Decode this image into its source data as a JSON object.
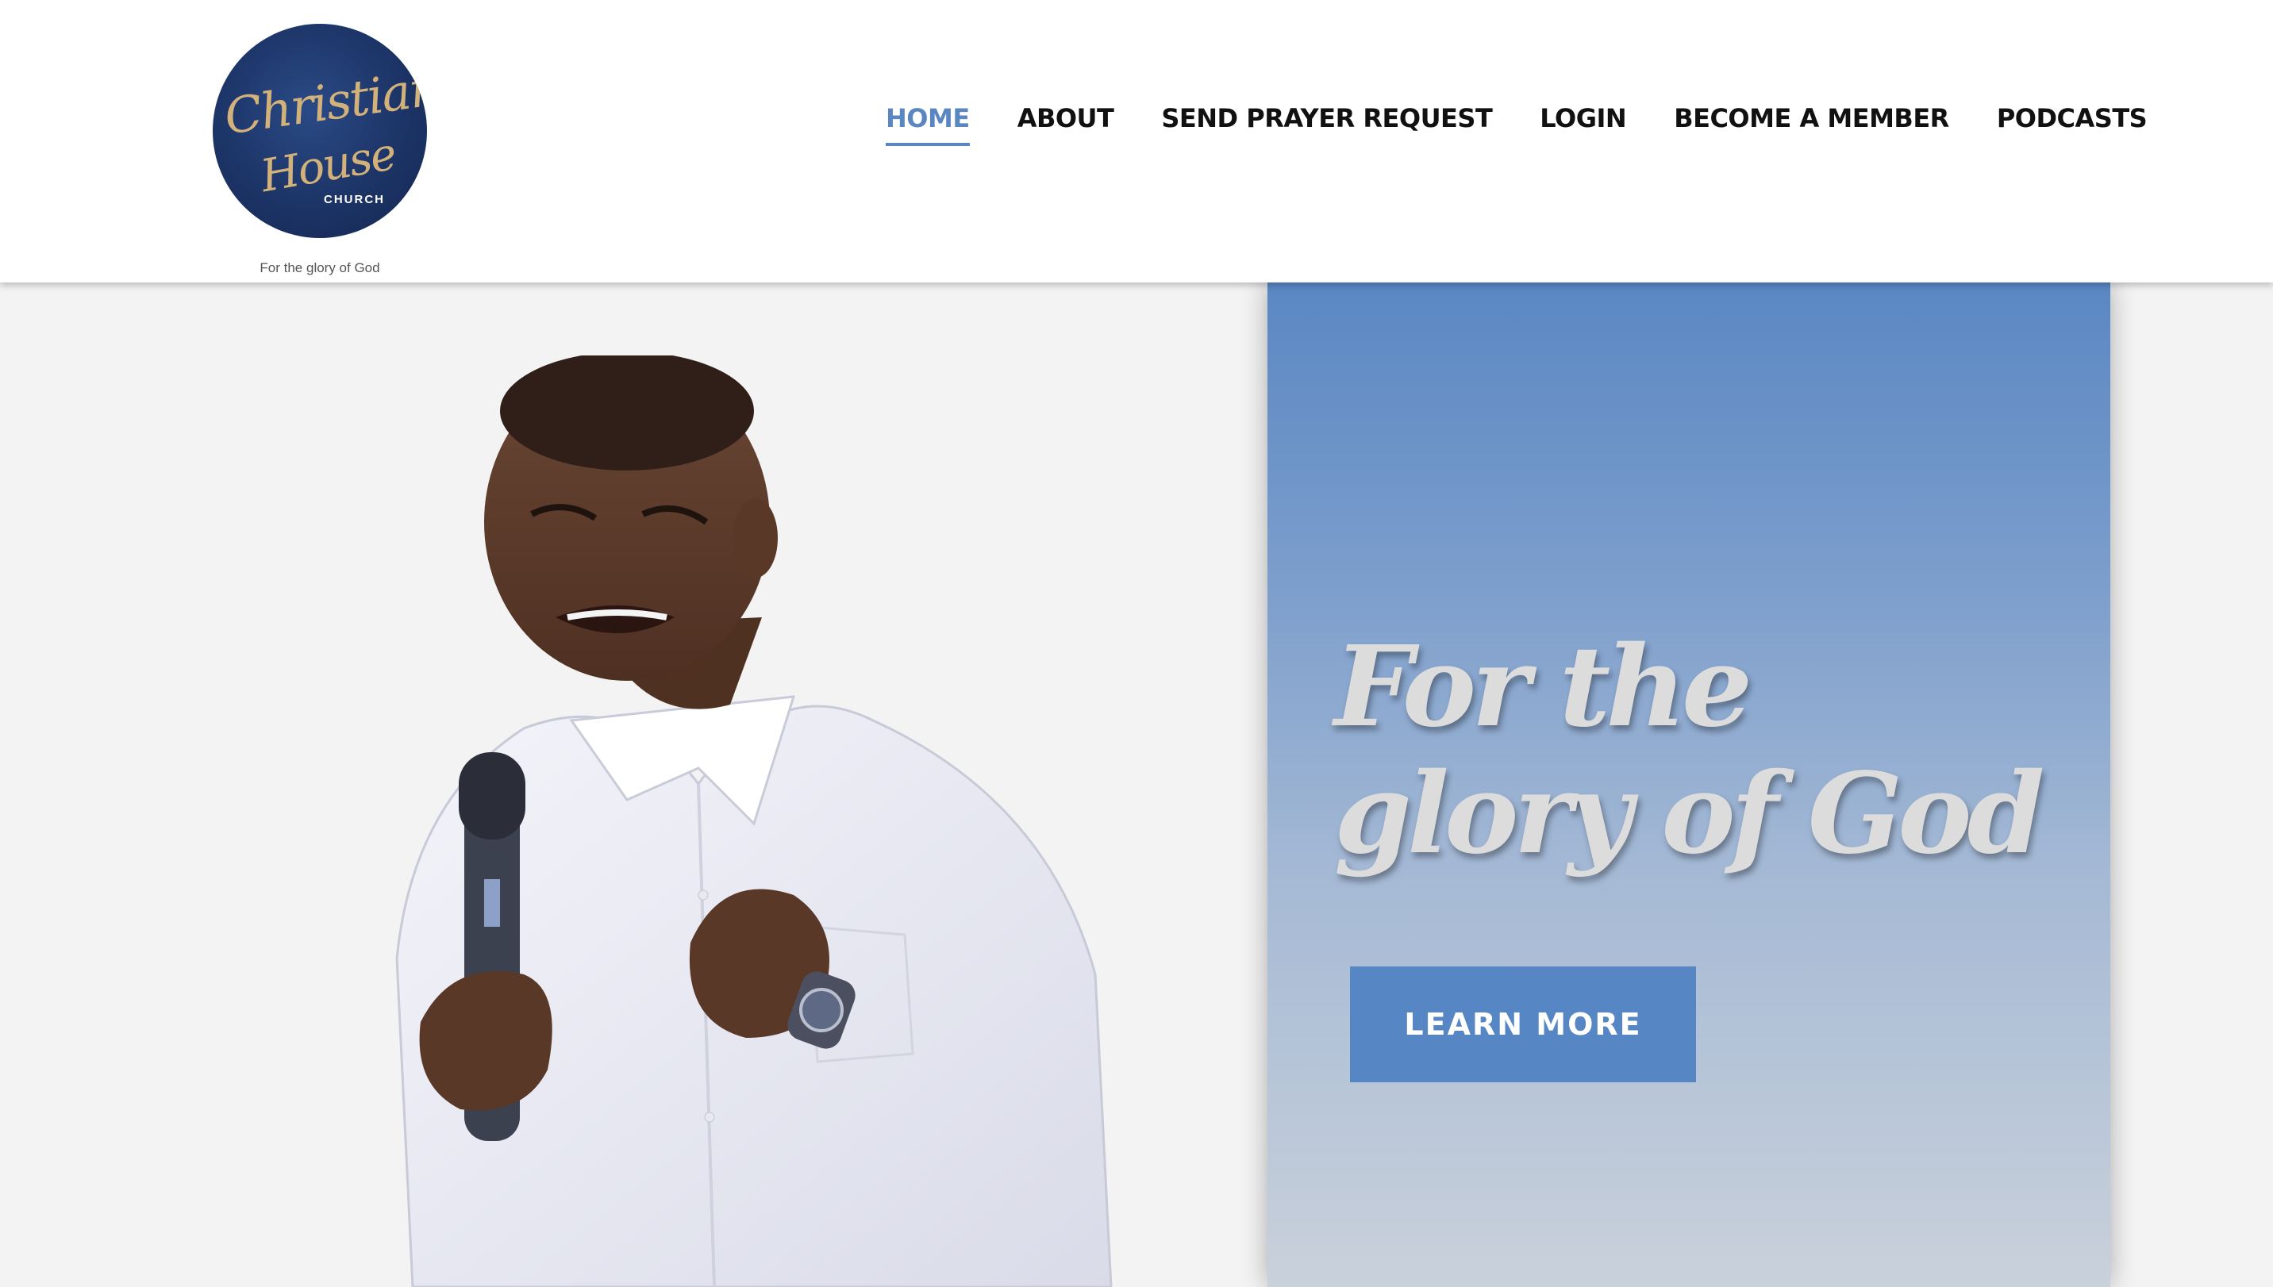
{
  "logo": {
    "line1": "Christian",
    "line2": "House",
    "line3": "CHURCH",
    "tagline": "For the glory of God"
  },
  "nav": {
    "items": [
      {
        "label": "HOME",
        "active": true
      },
      {
        "label": "ABOUT",
        "active": false
      },
      {
        "label": "SEND PRAYER REQUEST",
        "active": false
      },
      {
        "label": "LOGIN",
        "active": false
      },
      {
        "label": "BECOME A MEMBER",
        "active": false
      },
      {
        "label": "PODCASTS",
        "active": false
      }
    ]
  },
  "hero": {
    "heading": "For the glory of God",
    "button_label": "LEARN MORE"
  },
  "colors": {
    "accent": "#5a86c2",
    "logo_navy": "#1c3466",
    "logo_gold": "#d2b27a",
    "heading_text": "#dcdcdc",
    "page_bg": "#f3f3f3"
  }
}
